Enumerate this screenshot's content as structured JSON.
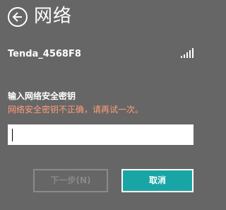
{
  "header": {
    "title": "网络",
    "back_icon": "back-arrow-icon"
  },
  "network": {
    "ssid": "Tenda_4568F8",
    "signal_icon": "signal-strength-icon",
    "signal_level": "5 of 5 bars"
  },
  "form": {
    "label": "输入网络安全密钥",
    "error": "网络安全密钥不正确，请再试一次。",
    "password_value": ""
  },
  "buttons": {
    "next_label": "下一步(N)",
    "cancel_label": "取消"
  },
  "colors": {
    "background": "#666666",
    "error_text": "#ff9c7a",
    "accent": "#19a5a5",
    "disabled": "#8a8a8a"
  }
}
